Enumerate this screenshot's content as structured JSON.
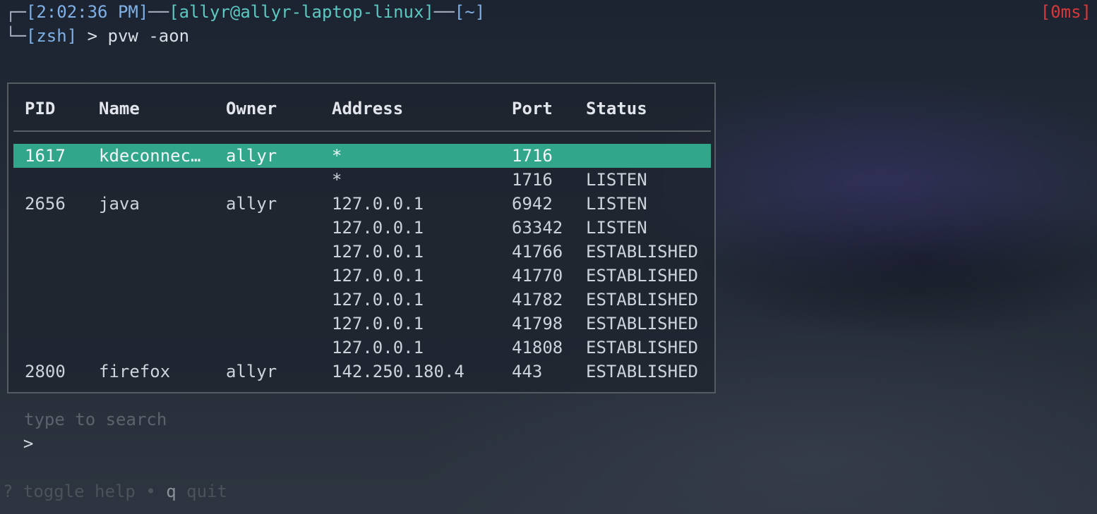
{
  "prompt": {
    "corner_top": "┌─",
    "time": "[2:02:36 PM]",
    "dash1": "──",
    "user_host": "[allyr@allyr-laptop-linux]",
    "dash2": "──",
    "cwd": "[~]",
    "corner_bottom": "└─",
    "shell": "[zsh]",
    "arrow": " > ",
    "command": "pvw -aon",
    "timer": "[0ms]"
  },
  "colors": {
    "selected_row": "#32a68a",
    "timer": "#d6393b",
    "user_host": "#5cc8c2",
    "bracket": "#7fb0e6"
  },
  "table": {
    "headers": {
      "pid": "PID",
      "name": "Name",
      "owner": "Owner",
      "address": "Address",
      "port": "Port",
      "status": "Status"
    },
    "rows": [
      {
        "pid": "1617",
        "name": "kdeconnec…",
        "owner": "allyr",
        "address": "*",
        "port": "1716",
        "status": "",
        "selected": true
      },
      {
        "pid": "",
        "name": "",
        "owner": "",
        "address": "*",
        "port": "1716",
        "status": "LISTEN",
        "selected": false
      },
      {
        "pid": "2656",
        "name": "java",
        "owner": "allyr",
        "address": "127.0.0.1",
        "port": "6942",
        "status": "LISTEN",
        "selected": false
      },
      {
        "pid": "",
        "name": "",
        "owner": "",
        "address": "127.0.0.1",
        "port": "63342",
        "status": "LISTEN",
        "selected": false
      },
      {
        "pid": "",
        "name": "",
        "owner": "",
        "address": "127.0.0.1",
        "port": "41766",
        "status": "ESTABLISHED",
        "selected": false
      },
      {
        "pid": "",
        "name": "",
        "owner": "",
        "address": "127.0.0.1",
        "port": "41770",
        "status": "ESTABLISHED",
        "selected": false
      },
      {
        "pid": "",
        "name": "",
        "owner": "",
        "address": "127.0.0.1",
        "port": "41782",
        "status": "ESTABLISHED",
        "selected": false
      },
      {
        "pid": "",
        "name": "",
        "owner": "",
        "address": "127.0.0.1",
        "port": "41798",
        "status": "ESTABLISHED",
        "selected": false
      },
      {
        "pid": "",
        "name": "",
        "owner": "",
        "address": "127.0.0.1",
        "port": "41808",
        "status": "ESTABLISHED",
        "selected": false
      },
      {
        "pid": "2800",
        "name": "firefox",
        "owner": "allyr",
        "address": "142.250.180.4",
        "port": "443",
        "status": "ESTABLISHED",
        "selected": false
      }
    ]
  },
  "search": {
    "caret": ">",
    "placeholder": "type to search",
    "value": ""
  },
  "help": {
    "help_key": "?",
    "help_label": "toggle help",
    "separator": "•",
    "quit_key": "q",
    "quit_label": "quit"
  }
}
